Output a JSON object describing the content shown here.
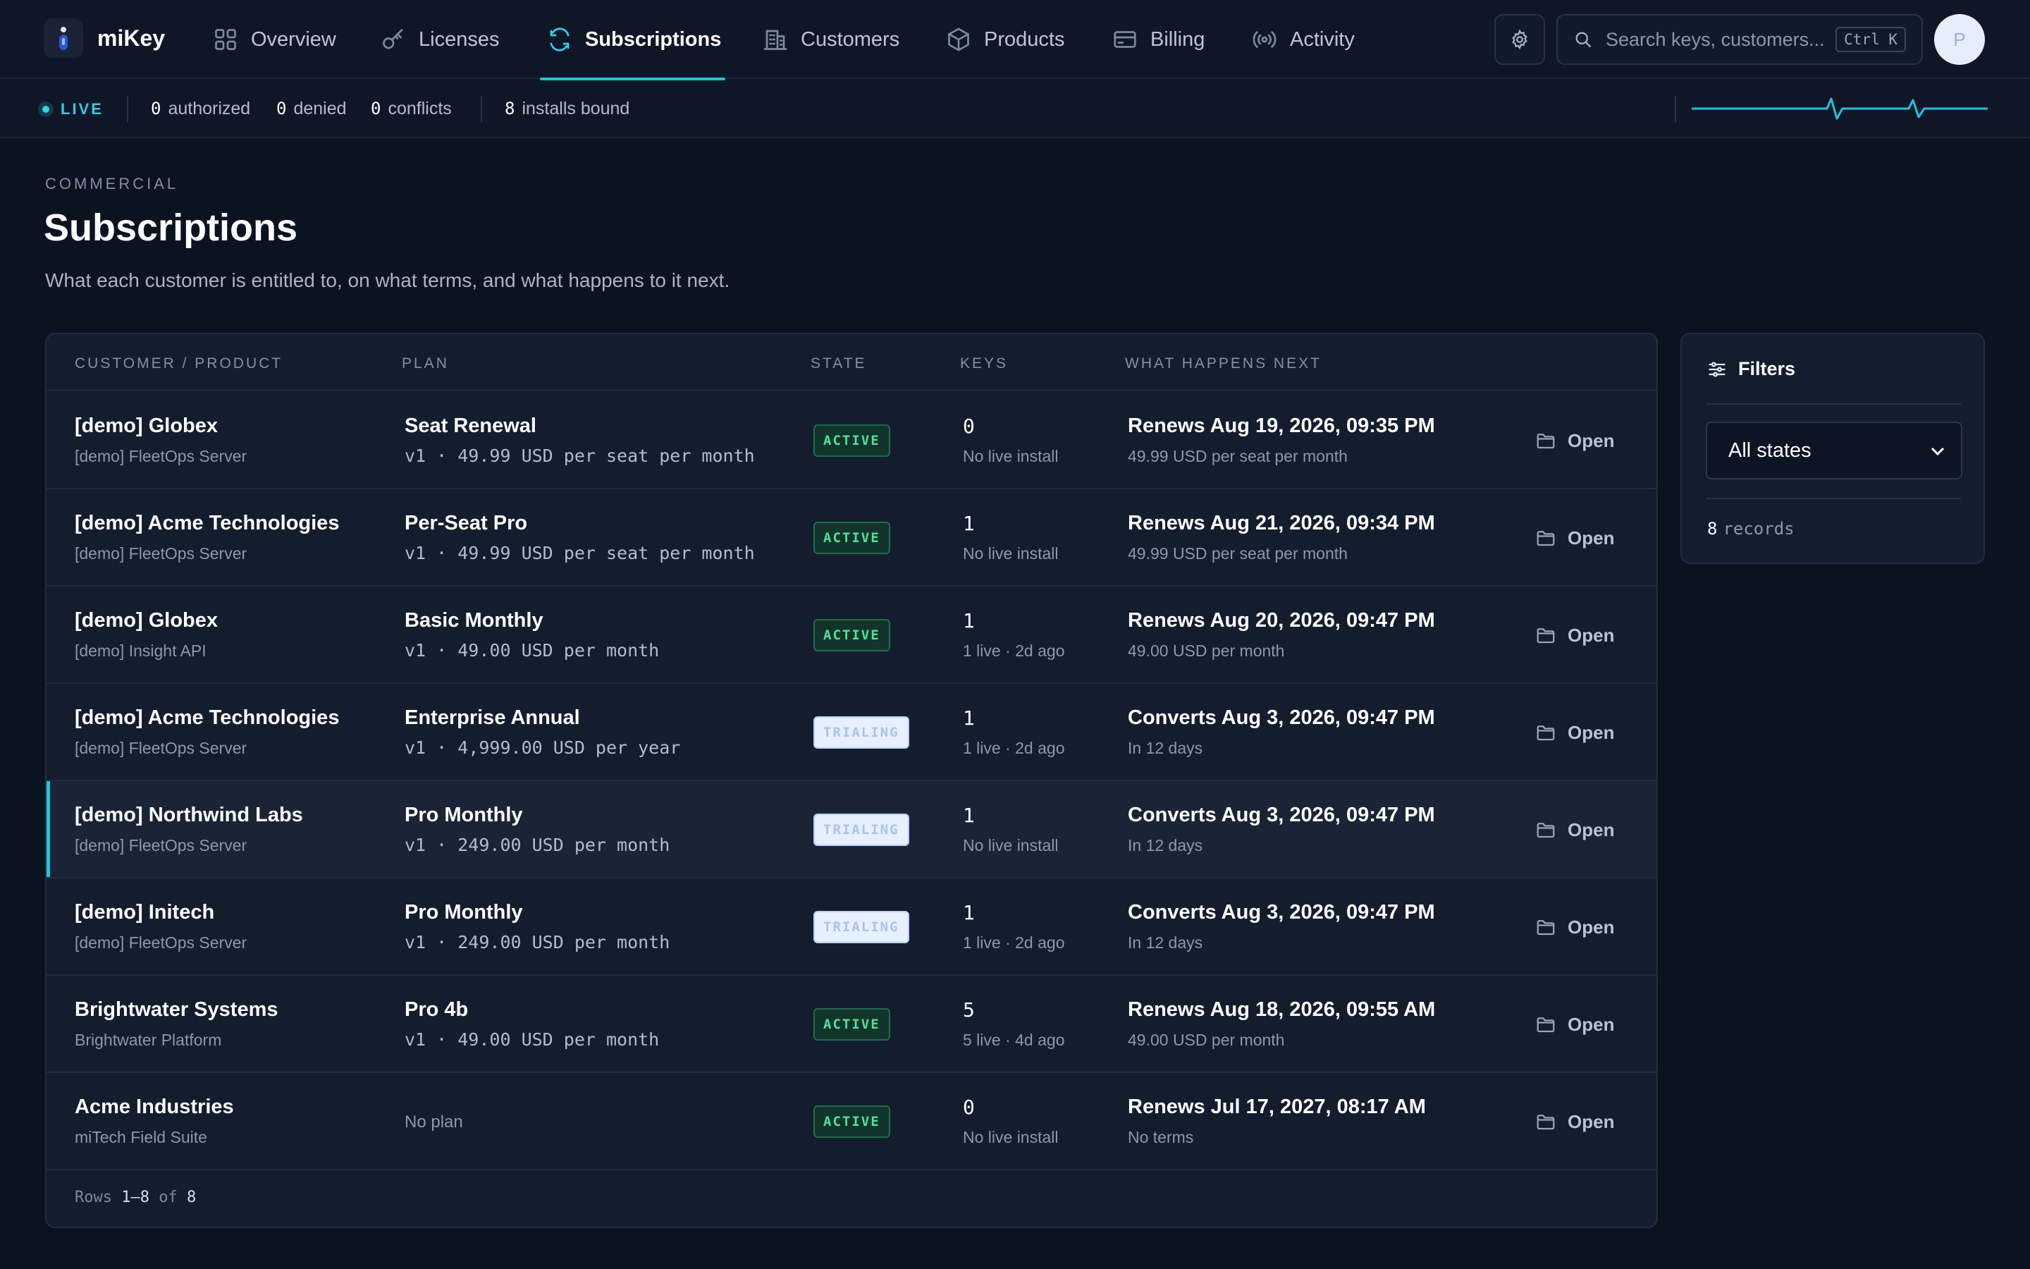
{
  "app": {
    "name": "miKey"
  },
  "nav": [
    {
      "label": "Overview",
      "icon": "grid-icon",
      "active": false
    },
    {
      "label": "Licenses",
      "icon": "key-icon",
      "active": false
    },
    {
      "label": "Subscriptions",
      "icon": "refresh-icon",
      "active": true
    },
    {
      "label": "Customers",
      "icon": "building-icon",
      "active": false
    },
    {
      "label": "Products",
      "icon": "box-icon",
      "active": false
    },
    {
      "label": "Billing",
      "icon": "credit-card-icon",
      "active": false
    },
    {
      "label": "Activity",
      "icon": "broadcast-icon",
      "active": false
    }
  ],
  "search": {
    "placeholder": "Search keys, customers...",
    "shortcut": "Ctrl K"
  },
  "user": {
    "avatar_initial": "P"
  },
  "status": {
    "live_label": "LIVE",
    "authorized": {
      "count": "0",
      "label": "authorized"
    },
    "denied": {
      "count": "0",
      "label": "denied"
    },
    "conflicts": {
      "count": "0",
      "label": "conflicts"
    },
    "installs": {
      "count": "8",
      "label": "installs bound"
    }
  },
  "colors": {
    "accent": "#22c3dd",
    "active_badge": "#4be2a0",
    "trialing_badge": "#e6f0ff",
    "background": "#0b1220"
  },
  "page": {
    "eyebrow": "COMMERCIAL",
    "title": "Subscriptions",
    "subtitle": "What each customer is entitled to, on what terms, and what happens to it next."
  },
  "table": {
    "columns": [
      "CUSTOMER / PRODUCT",
      "PLAN",
      "STATE",
      "KEYS",
      "WHAT HAPPENS NEXT"
    ],
    "action_label": "Open",
    "rows": [
      {
        "customer": "[demo] Globex",
        "product": "[demo] FleetOps Server",
        "plan": "Seat Renewal",
        "terms": "v1 · 49.99 USD per seat per month",
        "state": "ACTIVE",
        "keys": "0",
        "keys_note": "No live install",
        "next": "Renews Aug 19, 2026, 09:35 PM",
        "next_detail": "49.99 USD per seat per month",
        "selected": false
      },
      {
        "customer": "[demo] Acme Technologies",
        "product": "[demo] FleetOps Server",
        "plan": "Per-Seat Pro",
        "terms": "v1 · 49.99 USD per seat per month",
        "state": "ACTIVE",
        "keys": "1",
        "keys_note": "No live install",
        "next": "Renews Aug 21, 2026, 09:34 PM",
        "next_detail": "49.99 USD per seat per month",
        "selected": false
      },
      {
        "customer": "[demo] Globex",
        "product": "[demo] Insight API",
        "plan": "Basic Monthly",
        "terms": "v1 · 49.00 USD per month",
        "state": "ACTIVE",
        "keys": "1",
        "keys_note": "1 live · 2d ago",
        "next": "Renews Aug 20, 2026, 09:47 PM",
        "next_detail": "49.00 USD per month",
        "selected": false
      },
      {
        "customer": "[demo] Acme Technologies",
        "product": "[demo] FleetOps Server",
        "plan": "Enterprise Annual",
        "terms": "v1 · 4,999.00 USD per year",
        "state": "TRIALING",
        "keys": "1",
        "keys_note": "1 live · 2d ago",
        "next": "Converts Aug 3, 2026, 09:47 PM",
        "next_detail": "In 12 days",
        "selected": false
      },
      {
        "customer": "[demo] Northwind Labs",
        "product": "[demo] FleetOps Server",
        "plan": "Pro Monthly",
        "terms": "v1 · 249.00 USD per month",
        "state": "TRIALING",
        "keys": "1",
        "keys_note": "No live install",
        "next": "Converts Aug 3, 2026, 09:47 PM",
        "next_detail": "In 12 days",
        "selected": true
      },
      {
        "customer": "[demo] Initech",
        "product": "[demo] FleetOps Server",
        "plan": "Pro Monthly",
        "terms": "v1 · 249.00 USD per month",
        "state": "TRIALING",
        "keys": "1",
        "keys_note": "1 live · 2d ago",
        "next": "Converts Aug 3, 2026, 09:47 PM",
        "next_detail": "In 12 days",
        "selected": false
      },
      {
        "customer": "Brightwater Systems",
        "product": "Brightwater Platform",
        "plan": "Pro 4b",
        "terms": "v1 · 49.00 USD per month",
        "state": "ACTIVE",
        "keys": "5",
        "keys_note": "5 live · 4d ago",
        "next": "Renews Aug 18, 2026, 09:55 AM",
        "next_detail": "49.00 USD per month",
        "selected": false
      },
      {
        "customer": "Acme Industries",
        "product": "miTech Field Suite",
        "plan": "",
        "plan_placeholder": "No plan",
        "terms": "",
        "state": "ACTIVE",
        "keys": "0",
        "keys_note": "No live install",
        "next": "Renews Jul 17, 2027, 08:17 AM",
        "next_detail": "No terms",
        "selected": false
      }
    ],
    "footer": {
      "prefix": "Rows",
      "range": "1–8",
      "of_label": "of",
      "total": "8"
    }
  },
  "filters": {
    "title": "Filters",
    "state_options": [
      "All states"
    ],
    "state_selected": "All states",
    "records_count": "8",
    "records_label": "records"
  }
}
